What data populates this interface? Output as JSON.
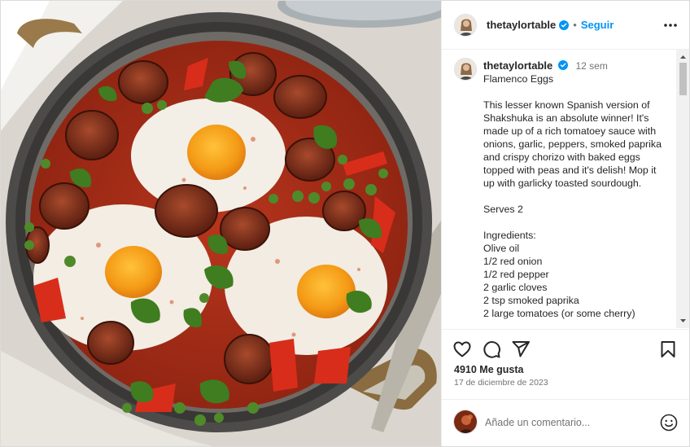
{
  "post": {
    "image_alt": "Flamenco eggs in a round pan",
    "author": "thetaylortable"
  },
  "header": {
    "username": "thetaylortable",
    "separator": "•",
    "follow_label": "Seguir",
    "more_icon": "more-horizontal-icon"
  },
  "caption": {
    "username": "thetaylortable",
    "time": "12 sem",
    "text": "Flamenco Eggs\n\nThis lesser known Spanish version of Shakshuka is an absolute winner! It's made up of a rich tomatoey sauce with onions, garlic, peppers, smoked paprika and crispy chorizo with baked eggs topped with peas and it's delish! Mop it up with garlicky toasted sourdough.\n\nServes 2\n\nIngredients:\nOlive oil\n1/2 red onion\n1/2 red pepper\n2 garlic cloves\n2 tsp smoked paprika\n2 large tomatoes (or some cherry)"
  },
  "actions": {
    "icons": [
      "heart-icon",
      "comment-icon",
      "share-icon",
      "bookmark-icon"
    ]
  },
  "likes_text": "4910 Me gusta",
  "date_text": "17 de diciembre de 2023",
  "comment": {
    "placeholder": "Añade un comentario..."
  },
  "colors": {
    "accent": "#0095f6",
    "verified": "#0095f6",
    "text": "#262626",
    "secondary": "#737373"
  }
}
